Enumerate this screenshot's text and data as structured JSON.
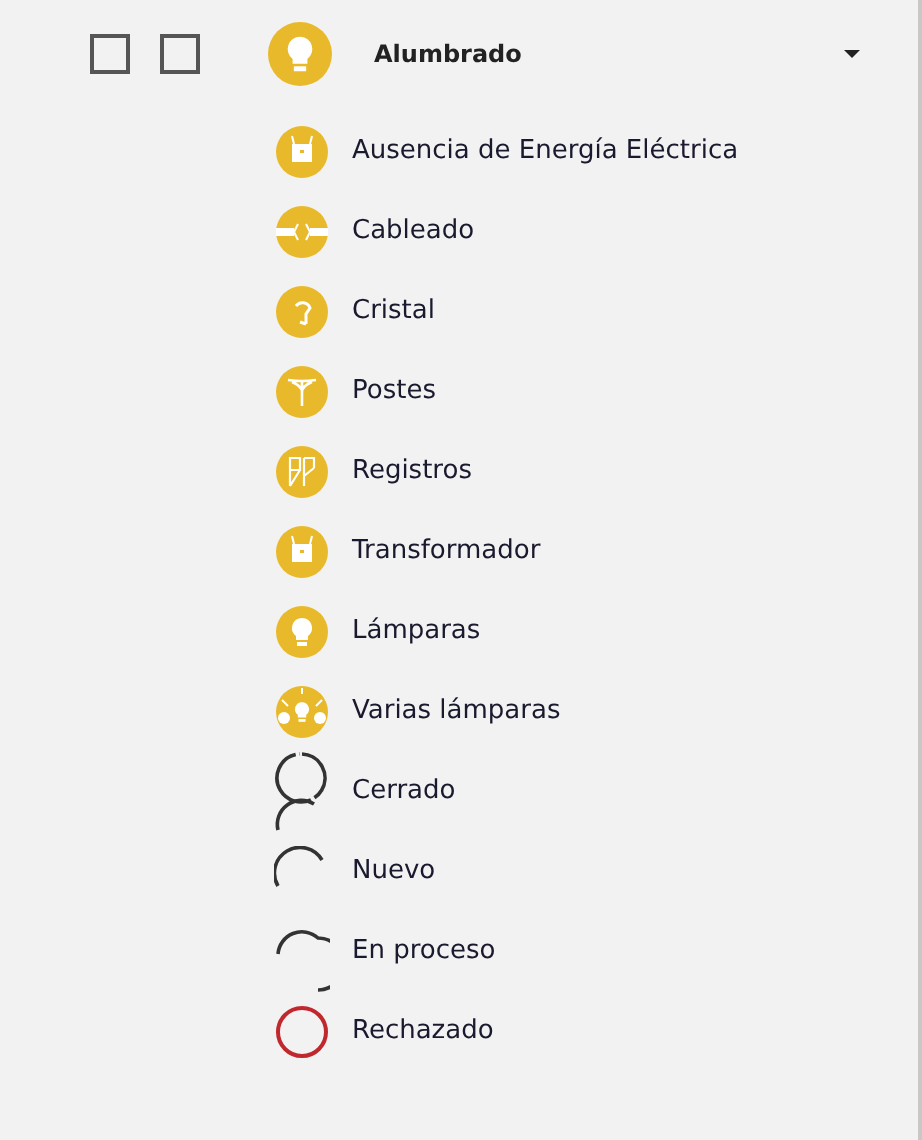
{
  "checkboxes": [
    {
      "checked": false
    },
    {
      "checked": false
    }
  ],
  "group": {
    "title": "Alumbrado",
    "expanded": true
  },
  "items": [
    {
      "kind": "energy",
      "label": "Ausencia de Energía Eléctrica"
    },
    {
      "kind": "cable",
      "label": "Cableado"
    },
    {
      "kind": "crystal",
      "label": "Cristal"
    },
    {
      "kind": "pole",
      "label": "Postes"
    },
    {
      "kind": "registry",
      "label": "Registros"
    },
    {
      "kind": "transformer",
      "label": "Transformador"
    },
    {
      "kind": "lamp",
      "label": "Lámparas"
    },
    {
      "kind": "lamps",
      "label": "Varias lámparas"
    },
    {
      "kind": "closed",
      "label": "Cerrado"
    },
    {
      "kind": "new",
      "label": "Nuevo"
    },
    {
      "kind": "in_progress",
      "label": "En proceso"
    },
    {
      "kind": "rejected",
      "label": "Rechazado"
    }
  ]
}
